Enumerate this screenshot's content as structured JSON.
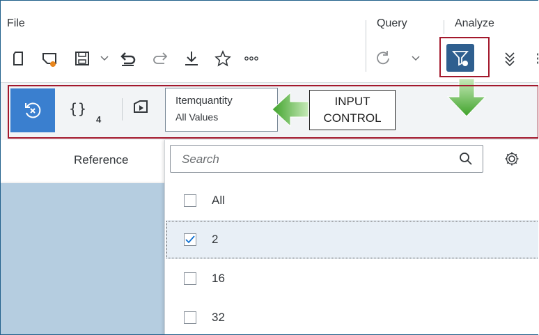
{
  "menu": {
    "file": "File",
    "query": "Query",
    "analyze": "Analyze"
  },
  "toolbar": {
    "icons": [
      "new-document-icon",
      "open-document-icon",
      "save-icon",
      "chevron-down-icon",
      "undo-icon",
      "redo-icon",
      "download-icon",
      "star-icon",
      "more-icon",
      "refresh-icon",
      "chevron-down-icon",
      "filter-icon",
      "expand-down-icon"
    ]
  },
  "input_control_bar": {
    "reset_icon": "reset-icon",
    "variables_label": "{}",
    "variables_count": "4",
    "token": {
      "name": "Itemquantity",
      "value": "All Values"
    }
  },
  "annotation": {
    "callout_line1": "INPUT",
    "callout_line2": "CONTROL",
    "arrow_color": "#4caf2a",
    "highlight_color": "#a3182c"
  },
  "table": {
    "column_header": "Reference"
  },
  "dropdown": {
    "search_placeholder": "Search",
    "items": [
      {
        "label": "All",
        "checked": false
      },
      {
        "label": "2",
        "checked": true
      },
      {
        "label": "16",
        "checked": false
      },
      {
        "label": "32",
        "checked": false
      }
    ]
  },
  "colors": {
    "accent": "#2f5f8f",
    "reset_button": "#3a7fcf",
    "left_pane": "#b5cde0"
  }
}
